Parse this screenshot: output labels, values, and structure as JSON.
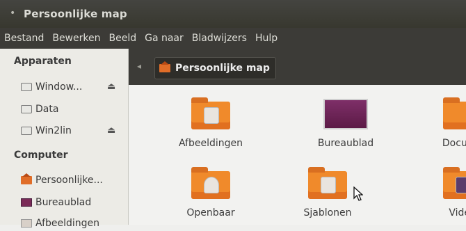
{
  "window": {
    "title": "Persoonlijke map",
    "close_glyph": "•"
  },
  "menu": {
    "items": [
      "Bestand",
      "Bewerken",
      "Beeld",
      "Ga naar",
      "Bladwijzers",
      "Hulp"
    ]
  },
  "sidebar": {
    "sections": [
      {
        "title": "Apparaten",
        "items": [
          {
            "label": "Window...",
            "icon": "drive-icon",
            "eject": true
          },
          {
            "label": "Data",
            "icon": "drive-icon",
            "eject": false
          },
          {
            "label": "Win2lin",
            "icon": "drive-icon",
            "eject": true
          }
        ]
      },
      {
        "title": "Computer",
        "items": [
          {
            "label": "Persoonlijke...",
            "icon": "home-folder-icon"
          },
          {
            "label": "Bureaublad",
            "icon": "desktop-icon"
          },
          {
            "label": "Afbeeldingen",
            "icon": "pictures-folder-icon"
          }
        ]
      }
    ],
    "eject_glyph": "⏏"
  },
  "path": {
    "arrow": "◂",
    "current": "Persoonlijke map"
  },
  "content": {
    "items": [
      {
        "label": "Afbeeldingen",
        "icon": "pictures-folder-icon"
      },
      {
        "label": "Bureaublad",
        "icon": "desktop-icon"
      },
      {
        "label": "Docume",
        "icon": "documents-folder-icon"
      },
      {
        "label": "Openbaar",
        "icon": "public-folder-icon"
      },
      {
        "label": "Sjablonen",
        "icon": "templates-folder-icon"
      },
      {
        "label": "Video",
        "icon": "videos-folder-icon"
      }
    ]
  },
  "colors": {
    "folder": "#f08a2b",
    "titlebar": "#3c3b37",
    "desktop": "#7a2a57"
  }
}
